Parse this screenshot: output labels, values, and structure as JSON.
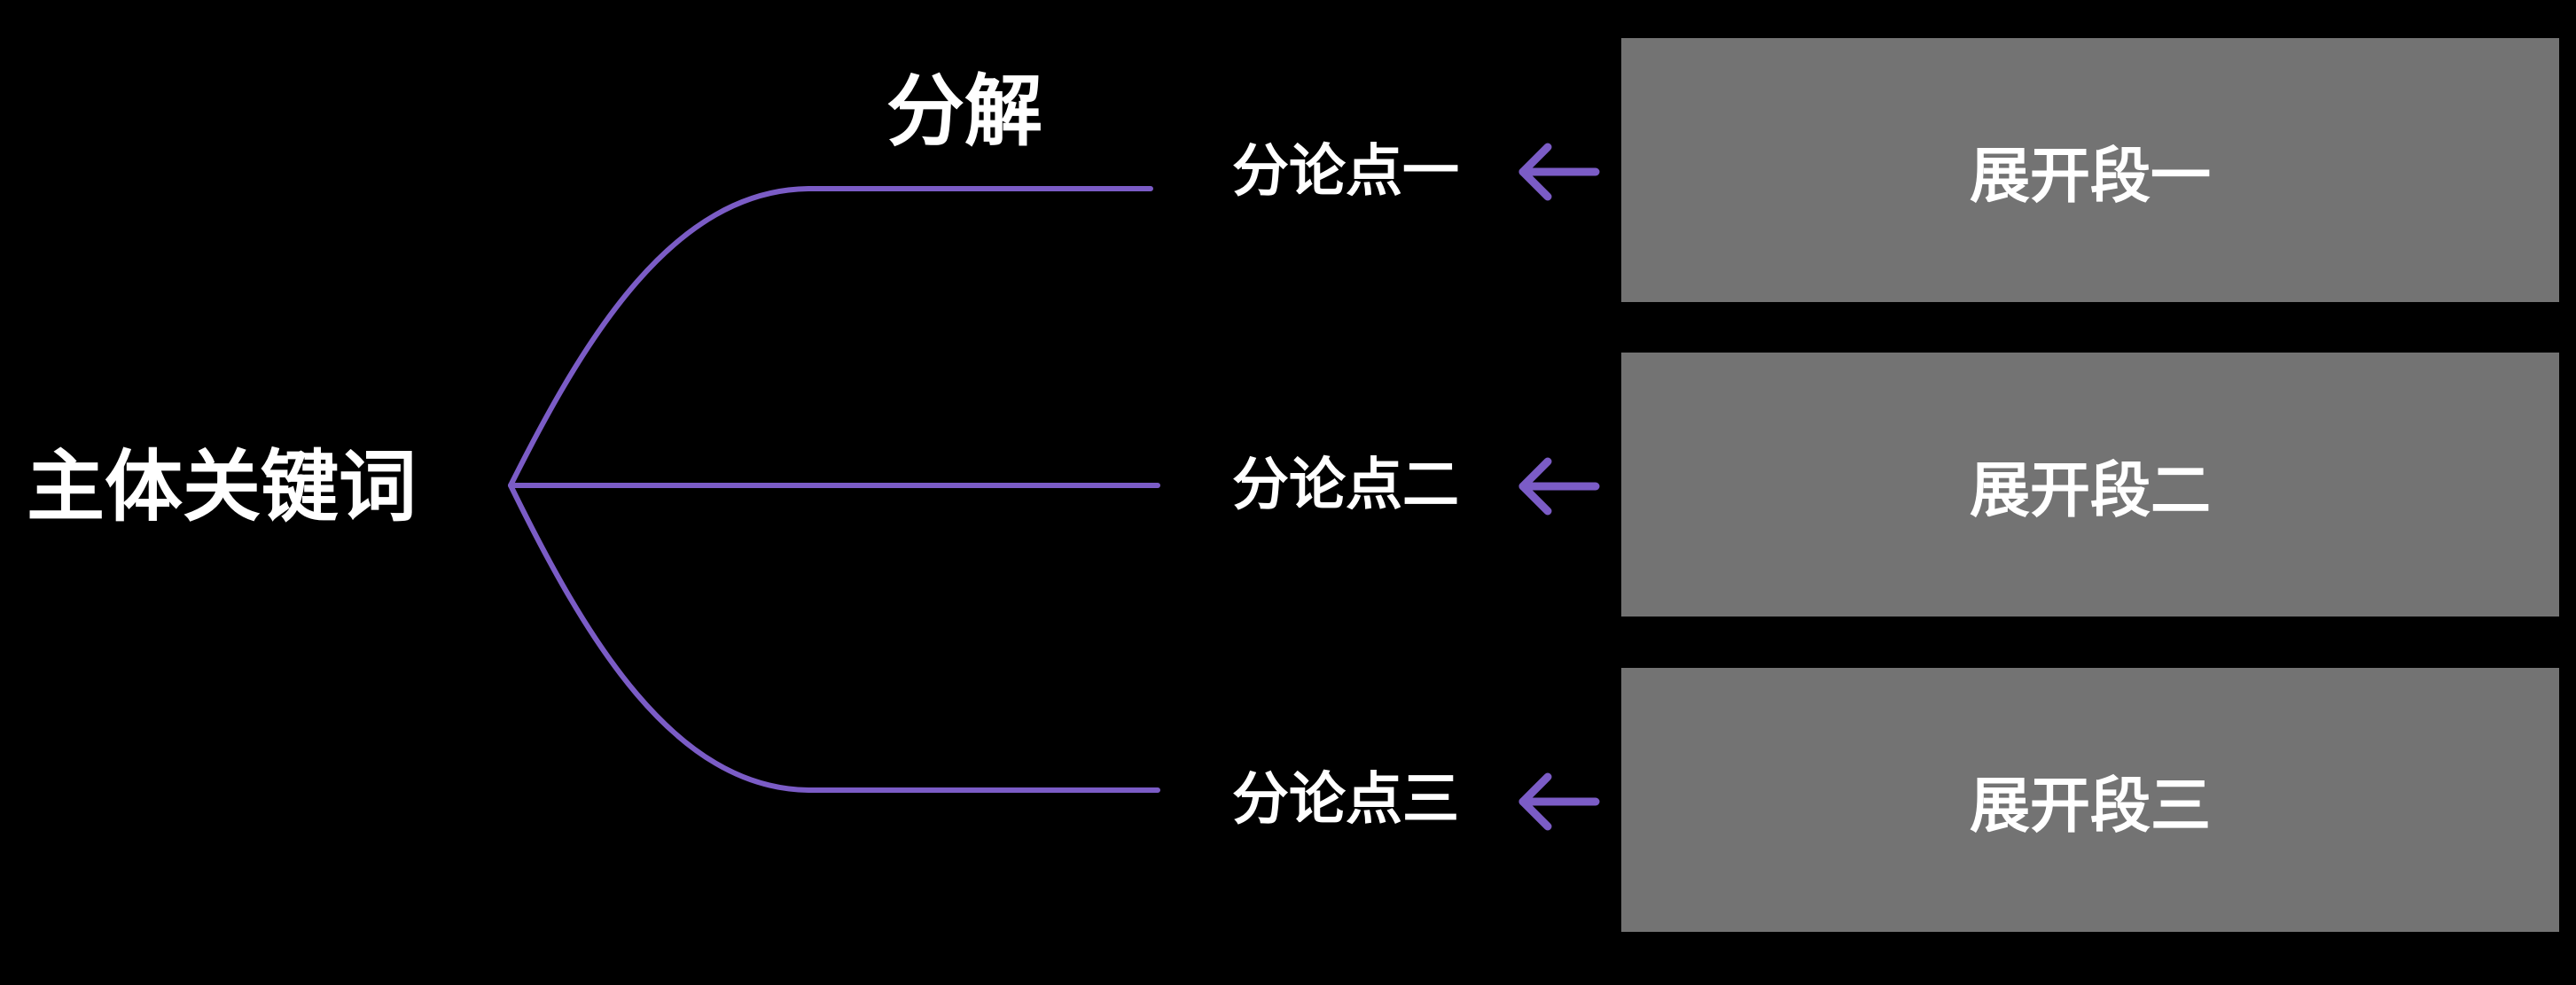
{
  "main_keyword": "主体关键词",
  "decompose_label": "分解",
  "sub_points": [
    "分论点一",
    "分论点二",
    "分论点三"
  ],
  "expansions": [
    "展开段一",
    "展开段二",
    "展开段三"
  ],
  "colors": {
    "background": "#000000",
    "connector": "#7b5cc6",
    "box": "#737373",
    "text": "#ffffff"
  },
  "icons": {
    "arrow": "arrow-left-icon"
  }
}
